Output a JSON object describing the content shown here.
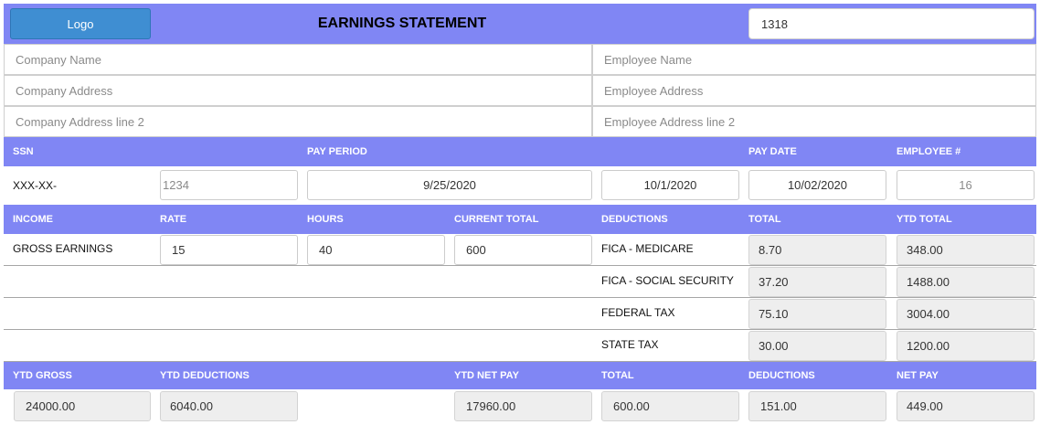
{
  "header": {
    "logo_label": "Logo",
    "title": "EARNINGS STATEMENT",
    "statement_number": "1318"
  },
  "company": {
    "name_placeholder": "Company Name",
    "address_placeholder": "Company Address",
    "address2_placeholder": "Company Address line 2"
  },
  "employee": {
    "name_placeholder": "Employee Name",
    "address_placeholder": "Employee Address",
    "address2_placeholder": "Employee Address line 2"
  },
  "pay_header": {
    "ssn": "SSN",
    "pay_period": "PAY PERIOD",
    "pay_date": "PAY DATE",
    "employee_no": "EMPLOYEE #"
  },
  "pay_info": {
    "ssn_prefix": "XXX-XX-",
    "ssn_last4": "1234",
    "period_start": "9/25/2020",
    "period_end": "10/1/2020",
    "pay_date": "10/02/2020",
    "employee_no": "16"
  },
  "income_header": {
    "income": "INCOME",
    "rate": "RATE",
    "hours": "HOURS",
    "current_total": "CURRENT TOTAL",
    "deductions": "DEDUCTIONS",
    "total": "TOTAL",
    "ytd_total": "YTD TOTAL"
  },
  "income": {
    "label": "GROSS EARNINGS",
    "rate": "15",
    "hours": "40",
    "current_total": "600"
  },
  "deductions": [
    {
      "label": "FICA - MEDICARE",
      "total": "8.70",
      "ytd": "348.00"
    },
    {
      "label": "FICA - SOCIAL SECURITY",
      "total": "37.20",
      "ytd": "1488.00"
    },
    {
      "label": "FEDERAL TAX",
      "total": "75.10",
      "ytd": "3004.00"
    },
    {
      "label": "STATE TAX",
      "total": "30.00",
      "ytd": "1200.00"
    }
  ],
  "summary_header": {
    "ytd_gross": "YTD GROSS",
    "ytd_deductions": "YTD DEDUCTIONS",
    "ytd_net_pay": "YTD NET PAY",
    "total": "TOTAL",
    "deductions": "DEDUCTIONS",
    "net_pay": "NET PAY"
  },
  "summary": {
    "ytd_gross": "24000.00",
    "ytd_deductions": "6040.00",
    "ytd_net_pay": "17960.00",
    "total": "600.00",
    "deductions": "151.00",
    "net_pay": "449.00"
  },
  "colors": {
    "header_band": "#8086f4",
    "logo_button": "#3f8ed2",
    "readonly_field": "#eeeeee"
  }
}
